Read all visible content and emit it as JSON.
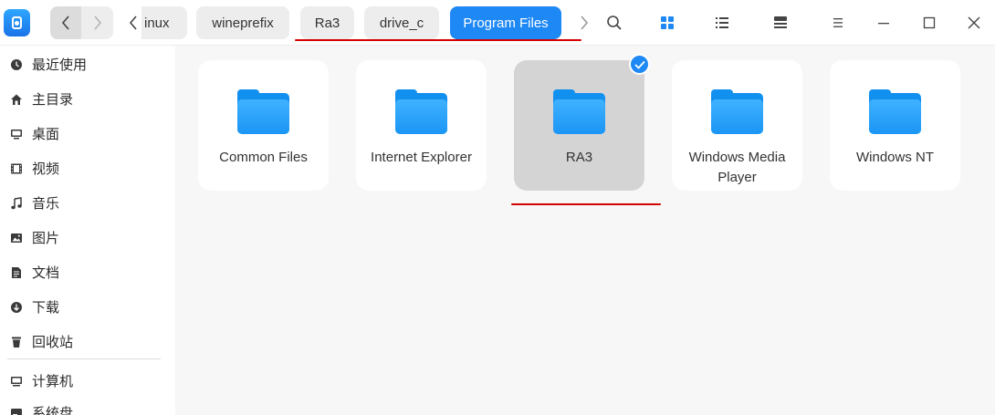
{
  "titlebar": {
    "app_icon": "file-manager-icon",
    "nav": {
      "back_icon": "chevron-left-icon",
      "forward_icon": "chevron-right-icon"
    },
    "breadcrumb": {
      "scroll_left_icon": "chevron-left-icon",
      "items": [
        {
          "label": "inux"
        },
        {
          "label": "wineprefix"
        },
        {
          "label": "Ra3"
        },
        {
          "label": "drive_c"
        },
        {
          "label": "Program Files",
          "active": true
        }
      ],
      "scroll_right_icon": "chevron-right-icon"
    },
    "tools": {
      "search_icon": "search-icon",
      "icon_view_icon": "grid-view-icon",
      "list_view_icon": "list-view-icon",
      "tree_view_icon": "tree-view-icon",
      "menu_icon": "menu-icon",
      "minimize_icon": "minimize-icon",
      "maximize_icon": "maximize-icon",
      "close_icon": "close-icon"
    }
  },
  "sidebar": {
    "items": [
      {
        "label": "最近使用",
        "icon": "recent-icon"
      },
      {
        "label": "主目录",
        "icon": "home-icon"
      },
      {
        "label": "桌面",
        "icon": "desktop-icon"
      },
      {
        "label": "视频",
        "icon": "video-icon"
      },
      {
        "label": "音乐",
        "icon": "music-icon"
      },
      {
        "label": "图片",
        "icon": "picture-icon"
      },
      {
        "label": "文档",
        "icon": "document-icon"
      },
      {
        "label": "下载",
        "icon": "download-icon"
      },
      {
        "label": "回收站",
        "icon": "trash-icon"
      },
      {
        "label": "计算机",
        "icon": "computer-icon"
      },
      {
        "label": "系统盘",
        "icon": "disk-icon"
      }
    ]
  },
  "files": [
    {
      "name": "Common Files",
      "type": "folder"
    },
    {
      "name": "Internet Explorer",
      "type": "folder"
    },
    {
      "name": "RA3",
      "type": "folder",
      "selected": true
    },
    {
      "name": "Windows Media Player",
      "type": "folder"
    },
    {
      "name": "Windows NT",
      "type": "folder"
    }
  ],
  "colors": {
    "accent": "#1e88f5",
    "folder": "#1b96f5",
    "annotation": "#d40000"
  }
}
